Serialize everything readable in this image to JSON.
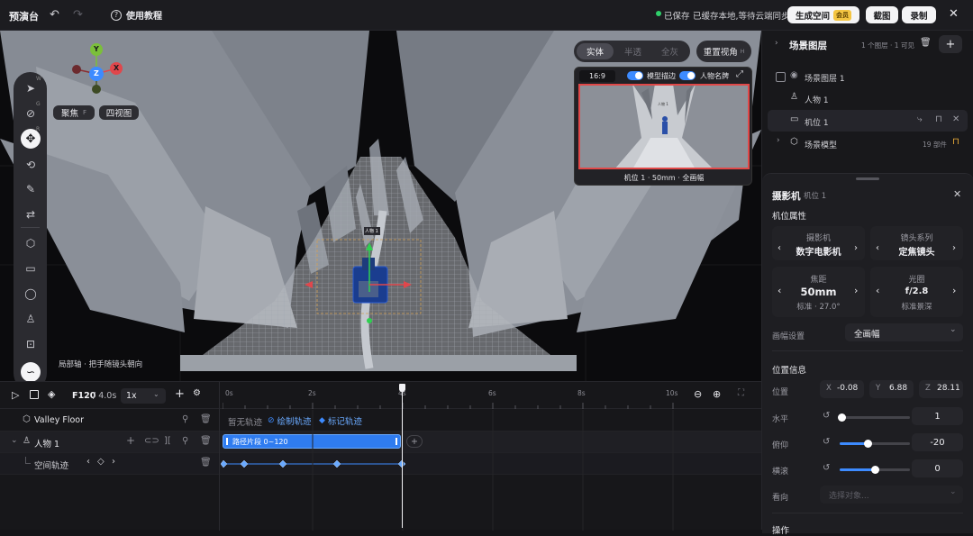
{
  "topbar": {
    "title": "预演台",
    "tutorial": "使用教程",
    "saved": "已保存",
    "sync_status": "已缓存本地,等待云端同步",
    "generate_space": "生成空间",
    "vip_badge": "会员",
    "screenshot": "截图",
    "record": "录制"
  },
  "viewport": {
    "render_modes": [
      "实体",
      "半透",
      "全灰"
    ],
    "reset_view": "重置视角",
    "reset_view_key": "H",
    "focus_label": "聚焦",
    "focus_key": "F",
    "quad_view": "四视图",
    "gizmo_axes": [
      "Y",
      "X",
      "Z"
    ],
    "local_axis_hint": "局部轴 · 把手随镜头朝向",
    "tool_keys": [
      "W",
      "G",
      "R"
    ],
    "character_tag": "人物 1",
    "preview": {
      "ratio": "16:9",
      "model_outline": "模型描边",
      "name_tag": "人物名牌",
      "caption": "机位 1 · 50mm · 全画幅",
      "inner_tag": "人物 1"
    }
  },
  "timeline": {
    "frame": "F120",
    "duration": "/ 4.0s",
    "speed": "1x",
    "ticks": [
      "0s",
      "2s",
      "4s",
      "6s",
      "8s",
      "10s"
    ],
    "tracks": {
      "floor": "Valley Floor",
      "no_track": "暂无轨迹",
      "draw_track": "绘制轨迹",
      "mark_track": "标记轨迹",
      "person": "人物 1",
      "clip": "路径片段 0~120",
      "space_track": "空间轨迹"
    }
  },
  "scene_layers": {
    "title": "场景图层",
    "meta": "1 个图层 · 1 可见",
    "items": [
      {
        "label": "场景图层 1"
      },
      {
        "label": "人物 1"
      },
      {
        "label": "机位 1"
      },
      {
        "label": "场景模型",
        "meta": "19 部件"
      }
    ]
  },
  "camera_panel": {
    "title": "摄影机",
    "subtitle": "机位 1",
    "section_props": "机位属性",
    "camera_label": "摄影机",
    "camera_value": "数字电影机",
    "lens_label": "镜头系列",
    "lens_value": "定焦镜头",
    "focal_label": "焦距",
    "focal_value": "50mm",
    "focal_sub": "标准 · 27.0°",
    "aperture_label": "光圈",
    "aperture_value": "f/2.8",
    "aperture_sub": "标准景深",
    "frame_label": "画幅设置",
    "frame_value": "全画幅",
    "section_pos": "位置信息",
    "pos_label": "位置",
    "x": "-0.08",
    "y": "6.88",
    "z": "28.11",
    "horizontal_label": "水平",
    "horizontal_value": "1",
    "horizontal_level": 0.03,
    "tilt_label": "俯仰",
    "tilt_value": "-20",
    "tilt_level": 0.4,
    "roll_label": "横滚",
    "roll_value": "0",
    "roll_level": 0.5,
    "look_label": "看向",
    "look_placeholder": "选择对象...",
    "section_ops": "操作"
  },
  "colors": {
    "accent": "#3d8bff",
    "panel_bg": "#18181b",
    "gizmo_y": "#7bbf3a",
    "gizmo_x": "#e0474c",
    "gizmo_z": "#3d8bff",
    "save_green": "#2fcf6a",
    "preview_frame": "#e04848"
  }
}
